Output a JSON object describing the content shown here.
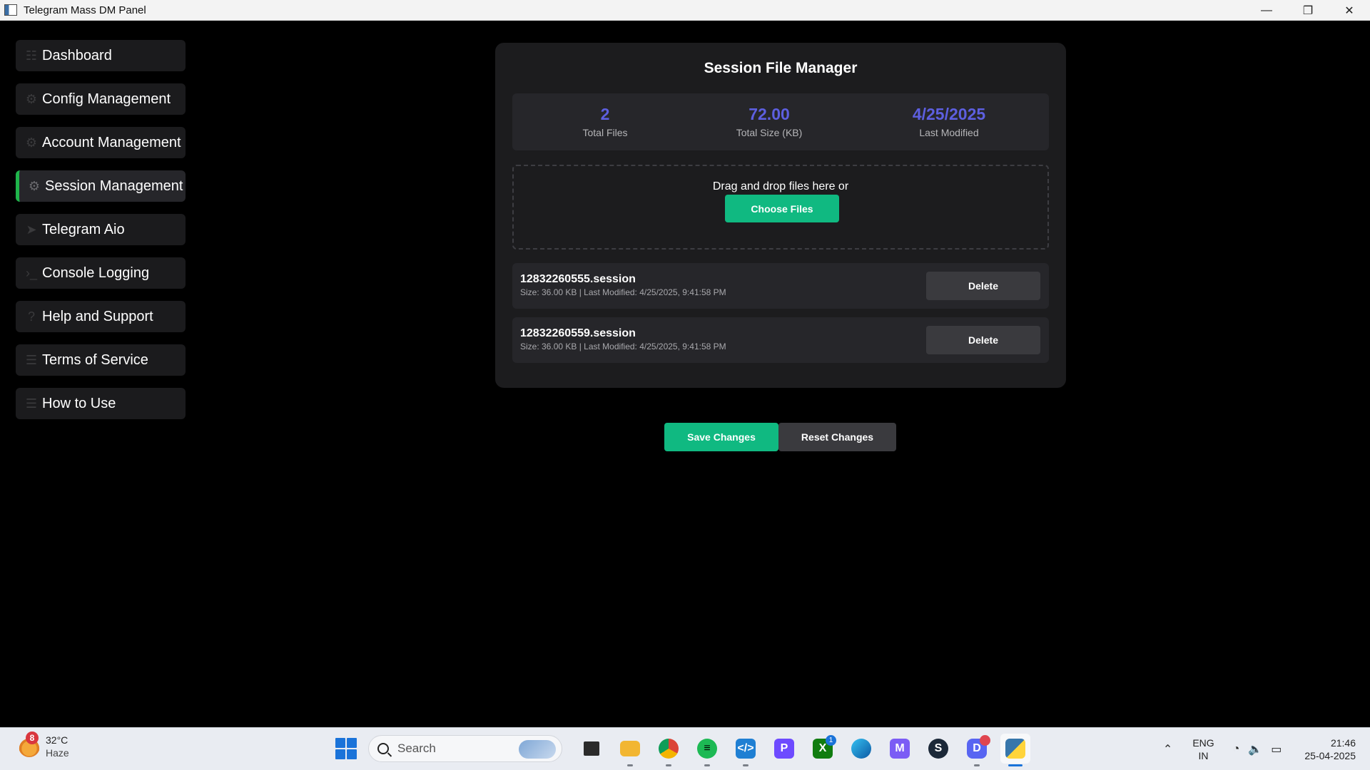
{
  "window": {
    "title": "Telegram Mass DM Panel"
  },
  "sidebar": {
    "items": [
      {
        "label": "Dashboard",
        "icon": "grid-icon",
        "active": false
      },
      {
        "label": "Config Management",
        "icon": "gear-icon",
        "active": false
      },
      {
        "label": "Account Management",
        "icon": "gear-icon",
        "active": false
      },
      {
        "label": "Session Management",
        "icon": "gear-icon",
        "active": true
      },
      {
        "label": "Telegram Aio",
        "icon": "send-icon",
        "active": false
      },
      {
        "label": "Console Logging",
        "icon": "terminal-icon",
        "active": false
      },
      {
        "label": "Help and Support",
        "icon": "help-icon",
        "active": false
      },
      {
        "label": "Terms of Service",
        "icon": "document-icon",
        "active": false
      },
      {
        "label": "How to Use",
        "icon": "document-icon",
        "active": false
      }
    ]
  },
  "session_manager": {
    "title": "Session File Manager",
    "stats": [
      {
        "value": "2",
        "label": "Total Files"
      },
      {
        "value": "72.00",
        "label": "Total Size (KB)"
      },
      {
        "value": "4/25/2025",
        "label": "Last Modified"
      }
    ],
    "dropzone": {
      "text": "Drag and drop files here or",
      "button": "Choose Files"
    },
    "files": [
      {
        "name": "12832260555.session",
        "meta": "Size: 36.00 KB | Last Modified: 4/25/2025, 9:41:58 PM",
        "delete_label": "Delete"
      },
      {
        "name": "12832260559.session",
        "meta": "Size: 36.00 KB | Last Modified: 4/25/2025, 9:41:58 PM",
        "delete_label": "Delete"
      }
    ]
  },
  "actions": {
    "save": "Save Changes",
    "reset": "Reset Changes"
  },
  "taskbar": {
    "weather": {
      "badge": "8",
      "temp": "32°C",
      "condition": "Haze"
    },
    "search_placeholder": "Search",
    "badges": {
      "xbox": "1"
    },
    "lang": {
      "line1": "ENG",
      "line2": "IN"
    },
    "clock": {
      "time": "21:46",
      "date": "25-04-2025"
    }
  },
  "colors": {
    "accent_green": "#10b981",
    "stat_value": "#5d5fe0",
    "active_indicator": "#1fb44b"
  }
}
